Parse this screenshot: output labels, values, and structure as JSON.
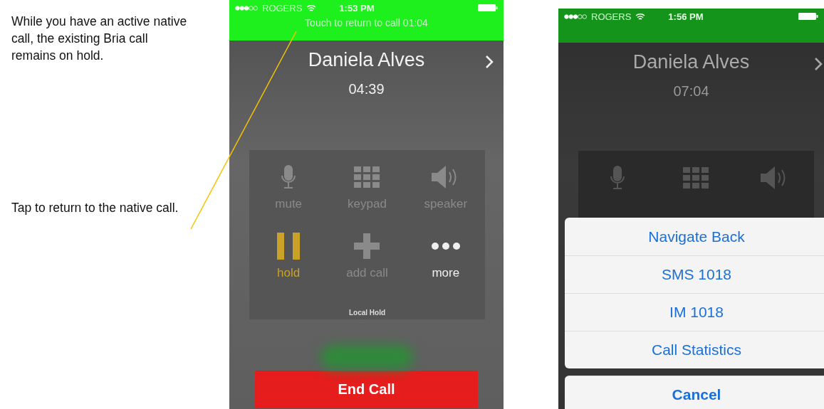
{
  "notes": [
    {
      "text": "While you have an active native call, the existing Bria call remains on hold."
    },
    {
      "text": "Tap to return to the native call."
    }
  ],
  "screens": [
    {
      "status": {
        "carrier": "ROGERS",
        "time": "1:53 PM"
      },
      "banner": "Touch to return to call  01:04",
      "contact": "Daniela Alves",
      "timer": "04:39",
      "controls": [
        {
          "kind": "mic",
          "label": "mute",
          "on": false,
          "disabled": true
        },
        {
          "kind": "keypad",
          "label": "keypad",
          "on": false,
          "disabled": true
        },
        {
          "kind": "speaker",
          "label": "speaker",
          "on": false,
          "disabled": true
        },
        {
          "kind": "pause",
          "label": "hold",
          "on": true
        },
        {
          "kind": "plus",
          "label": "add call",
          "on": false,
          "disabled": true
        },
        {
          "kind": "dots",
          "label": "more",
          "on": false,
          "disabled": false
        }
      ],
      "caption": "Local Hold",
      "end_button": "End Call"
    },
    {
      "status": {
        "carrier": "ROGERS",
        "time": "1:56 PM"
      },
      "contact": "Daniela Alves",
      "timer": "07:04",
      "controls": [
        {
          "kind": "mic",
          "disabled": true
        },
        {
          "kind": "keypad",
          "disabled": true
        },
        {
          "kind": "speaker",
          "disabled": true
        }
      ],
      "action_sheet": {
        "items": [
          "Navigate Back",
          "SMS 1018",
          "IM 1018",
          "Call Statistics"
        ],
        "cancel": "Cancel"
      }
    }
  ]
}
